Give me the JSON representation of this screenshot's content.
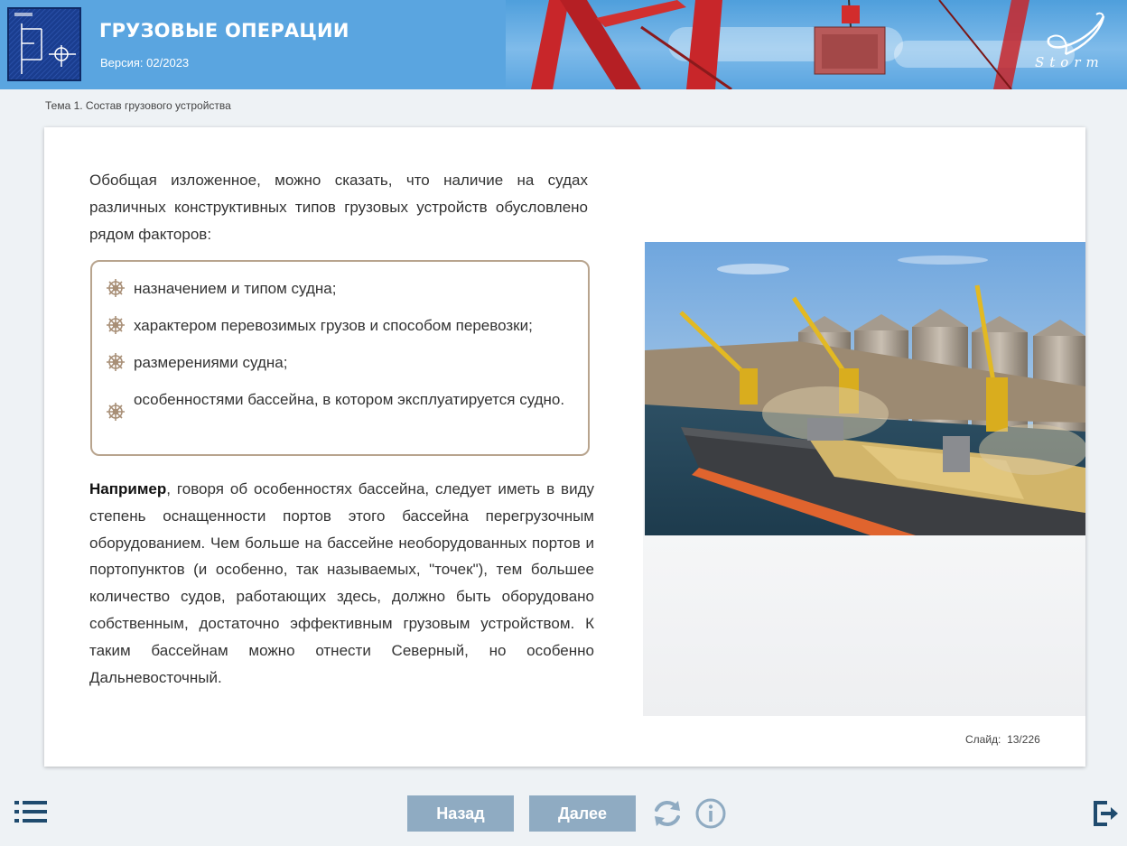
{
  "header": {
    "title": "ГРУЗОВЫЕ ОПЕРАЦИИ",
    "version": "Версия: 02/2023",
    "brand": "Storm"
  },
  "breadcrumb": "Тема 1. Состав грузового устройства",
  "content": {
    "intro": "Обобщая изложенное, можно сказать, что наличие на судах различных конструктивных типов грузовых устройств обусловлено рядом факторов:",
    "factors": [
      "назначением и типом судна;",
      "характером перевозимых грузов и способом перевозки;",
      "размерениями судна;",
      "особенностями бассейна, в котором эксплуатируется судно."
    ],
    "example_lead": "Например",
    "example_text": ", говоря об особенностях бассейна, следует иметь в виду степень оснащенности портов этого бассейна перегрузочным оборудованием. Чем больше на бассейне необорудованных портов и портопунктов (и особенно, так называемых, \"точек\"), тем большее количество судов, работающих здесь, должно быть оборудовано собственным, достаточно эффективным грузовым устройством. К таким бассейнам можно отнести Северный, но особенно Дальневосточный."
  },
  "slide_counter": {
    "label": "Слайд:",
    "current": "13",
    "separator": "/",
    "total": "226"
  },
  "controls": {
    "back_label": "Назад",
    "next_label": "Далее",
    "menu_icon": "list-menu-icon",
    "reload_icon": "reload-icon",
    "info_icon": "info-icon",
    "exit_icon": "exit-icon"
  },
  "colors": {
    "header_bg": "#5aa5e0",
    "nav_button_bg": "#8fabc2",
    "icon_dark": "#1f4b6e",
    "factor_border": "#b8a48e"
  }
}
